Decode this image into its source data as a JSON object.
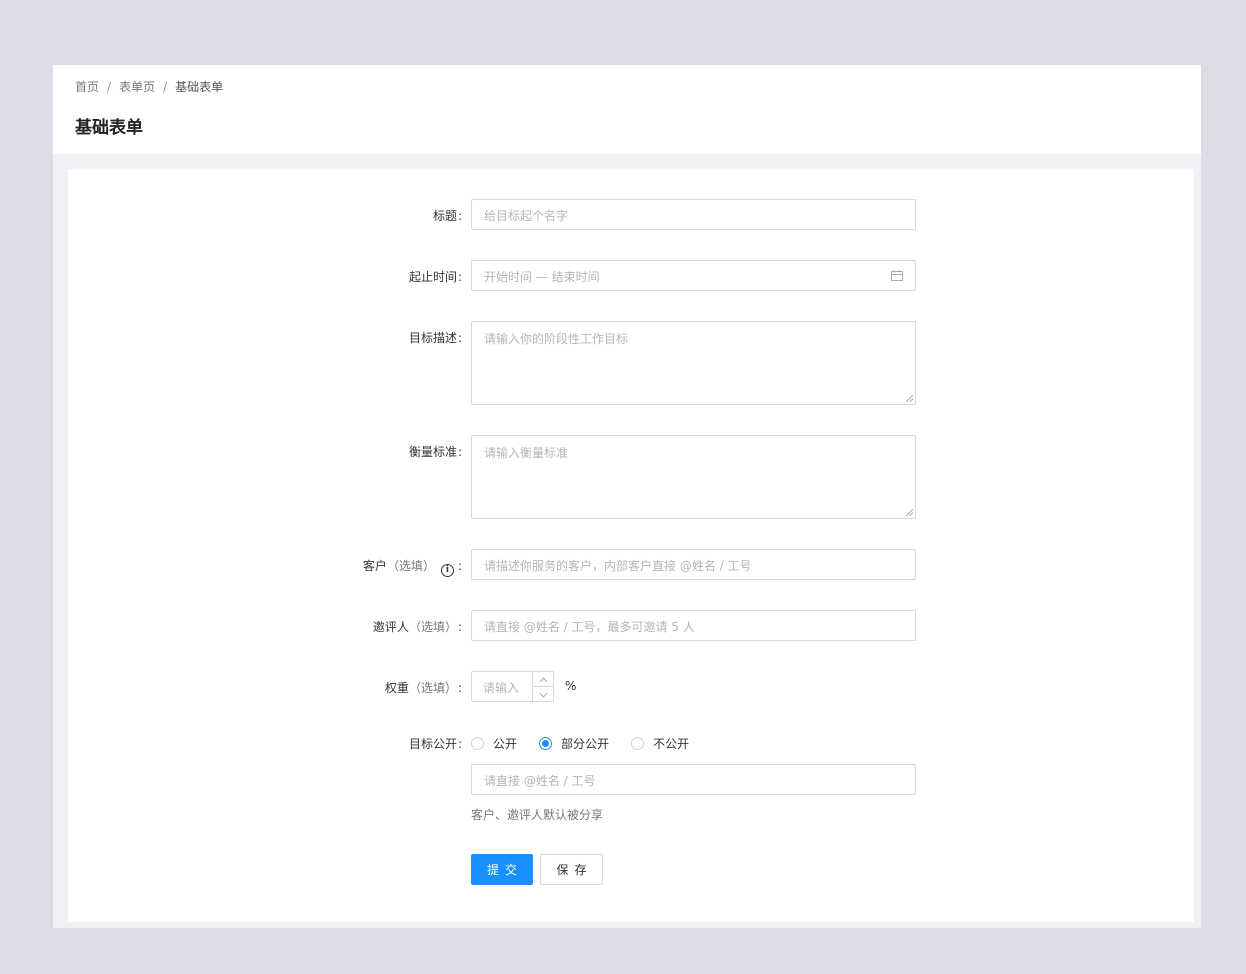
{
  "breadcrumb": {
    "items": [
      "首页",
      "表单页",
      "基础表单"
    ],
    "separator": "/"
  },
  "page_title": "基础表单",
  "form": {
    "title": {
      "label": "标题",
      "placeholder": "给目标起个名字"
    },
    "date_range": {
      "label": "起止时间",
      "placeholder": "开始时间 — 结束时间",
      "icon": "calendar-icon"
    },
    "goal_desc": {
      "label": "目标描述",
      "placeholder": "请输入你的阶段性工作目标"
    },
    "metrics": {
      "label": "衡量标准",
      "placeholder": "请输入衡量标准"
    },
    "client": {
      "label": "客户",
      "optional": "（选填）",
      "info_icon": "i",
      "placeholder": "请描述你服务的客户，内部客户直接 @姓名 / 工号"
    },
    "reviewer": {
      "label": "邀评人",
      "optional": "（选填）",
      "placeholder": "请直接 @姓名 / 工号，最多可邀请 5 人"
    },
    "weight": {
      "label": "权重",
      "optional": "（选填）",
      "placeholder": "请输入",
      "unit": "%"
    },
    "visibility": {
      "label": "目标公开",
      "options": [
        "公开",
        "部分公开",
        "不公开"
      ],
      "selected": "部分公开",
      "share_placeholder": "请直接 @姓名 / 工号",
      "hint": "客户、邀评人默认被分享"
    },
    "colon": ":",
    "submit_label": "提交",
    "save_label": "保存"
  },
  "colors": {
    "primary": "#1890ff",
    "page_bg": "#dcdde4",
    "content_bg": "#f0f1f5"
  }
}
